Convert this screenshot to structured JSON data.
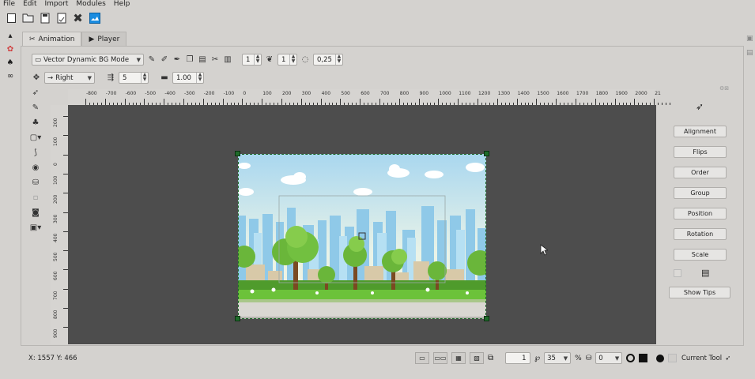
{
  "menu": {
    "file": "File",
    "edit": "Edit",
    "import": "Import",
    "modules": "Modules",
    "help": "Help"
  },
  "toolbar": {
    "icons": [
      "new-file-icon",
      "open-folder-icon",
      "save-icon",
      "save-as-icon",
      "close-icon",
      "image-icon"
    ]
  },
  "tabs": {
    "animation": "Animation",
    "player": "Player"
  },
  "options": {
    "mode": "Vector Dynamic BG Mode",
    "value1": "1",
    "value2": "1",
    "opacity": "0,25",
    "direction": "Right",
    "spacing": "5",
    "scale": "1.00"
  },
  "ruler": {
    "top": [
      "-800",
      "-700",
      "-600",
      "-500",
      "-400",
      "-300",
      "-200",
      "-100",
      "0",
      "100",
      "200",
      "300",
      "400",
      "500",
      "600",
      "700",
      "800",
      "900",
      "1000",
      "1100",
      "1200",
      "1300",
      "1400",
      "1500",
      "1600",
      "1700",
      "1800",
      "1900",
      "2000",
      "21"
    ],
    "left": [
      "200",
      "100",
      "0",
      "100",
      "200",
      "300",
      "400",
      "500",
      "600",
      "700",
      "800",
      "900"
    ]
  },
  "right_panel": {
    "alignment": "Alignment",
    "flips": "Flips",
    "order": "Order",
    "group": "Group",
    "position": "Position",
    "rotation": "Rotation",
    "scale": "Scale",
    "show_tips": "Show Tips"
  },
  "status": {
    "coords": "X: 1557 Y: 466"
  },
  "bottom": {
    "frame": "1",
    "brush_size": "35",
    "percent_label": "%",
    "layer": "0",
    "current_tool": "Current Tool"
  },
  "colors": {
    "canvas": "#4d4d4d",
    "handle": "#1f6b2a",
    "sky": "#cde8f5",
    "grass": "#6cc23a"
  }
}
